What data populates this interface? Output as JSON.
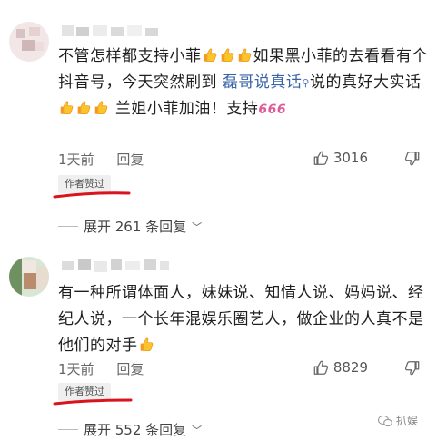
{
  "comments": [
    {
      "text_segments": [
        "不管怎样都支持小菲",
        "如果黑小菲的去看看有个抖音号，今天突然刷到 ",
        "磊哥说真话",
        "说的真好大实话",
        " 兰姐小菲加油！支持",
        "666"
      ],
      "time": "1天前",
      "reply_label": "回复",
      "like_count": "3016",
      "badge": "作者赞过",
      "expand_label": "展开 261 条回复"
    },
    {
      "text": "有一种所谓体面人，妹妹说、知情人说、妈妈说、经纪人说，一个长年混娱乐圈艺人，做企业的人真不是他们的对手",
      "time": "1天前",
      "reply_label": "回复",
      "like_count": "8829",
      "badge": "作者赞过",
      "expand_label": "展开 552 条回复"
    }
  ],
  "watermark": "扒娱",
  "colors": {
    "red_underline": "#d9141e",
    "link_blue": "#3a64a8"
  }
}
